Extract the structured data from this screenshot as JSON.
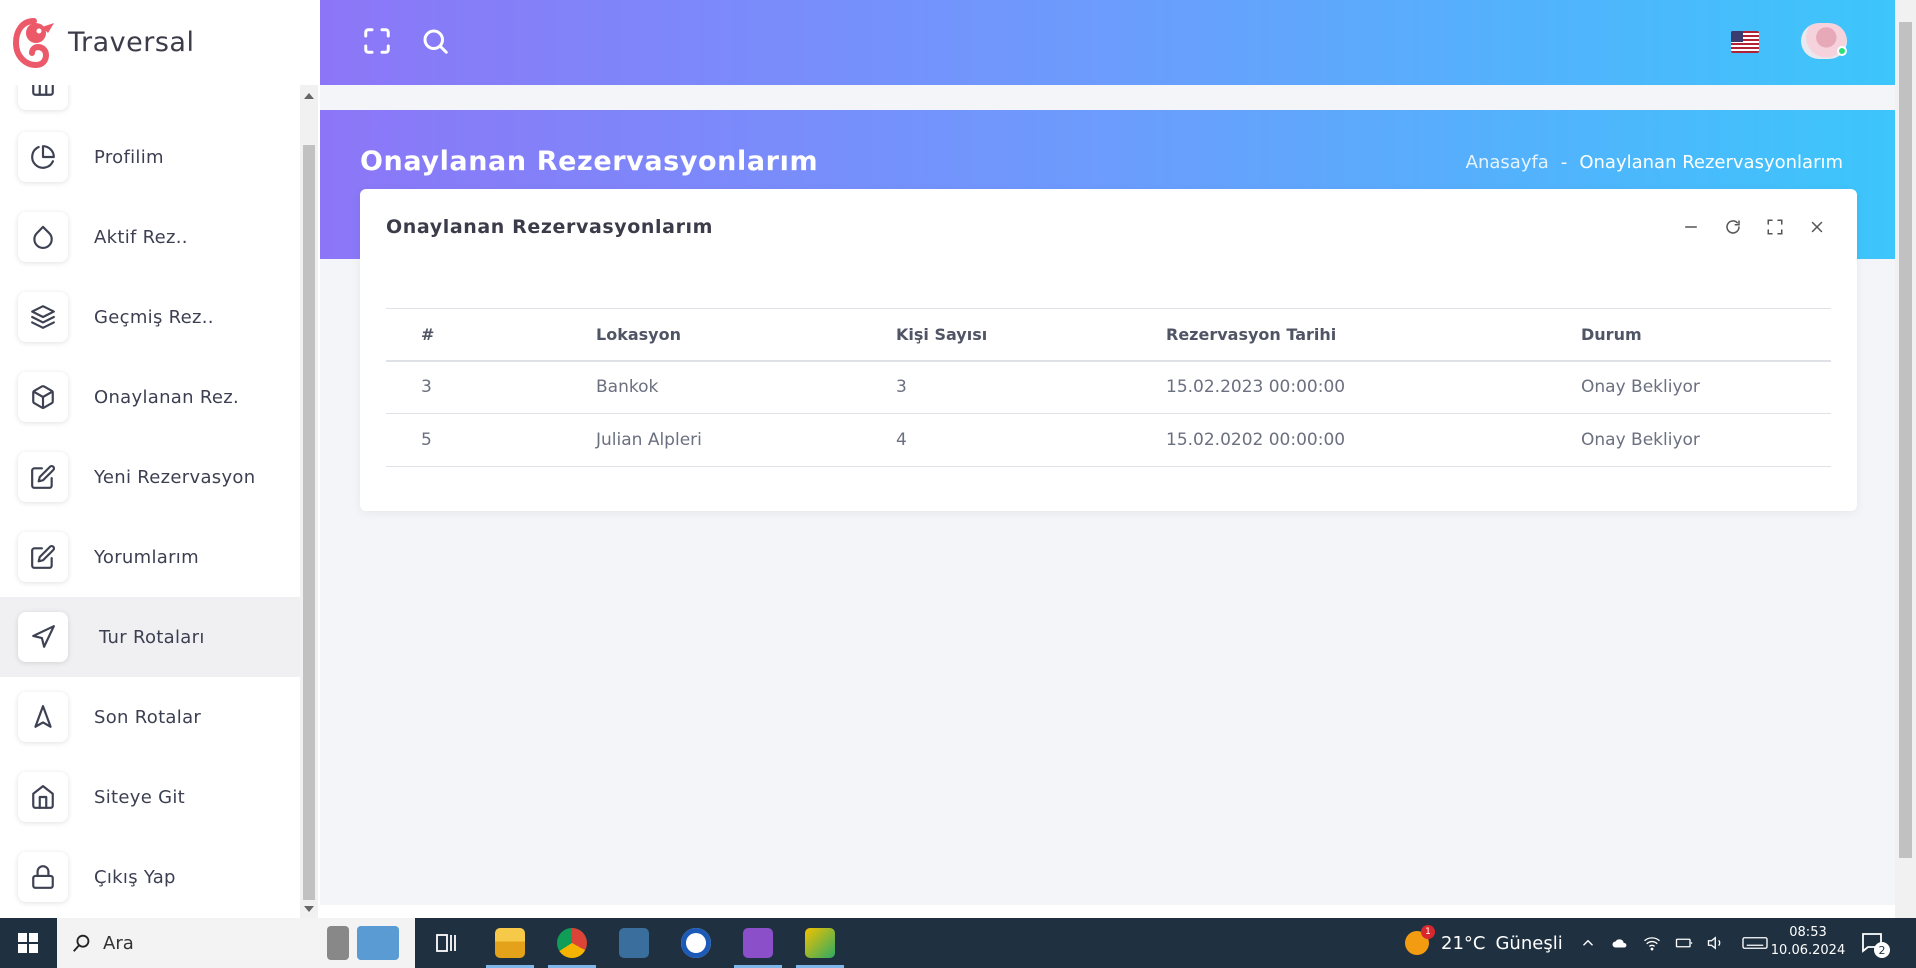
{
  "brand": {
    "name": "Traversal"
  },
  "sidebar": {
    "items": [
      {
        "label": "Profilim",
        "icon": "pie-chart-icon"
      },
      {
        "label": "Aktif Rez..",
        "icon": "droplet-icon"
      },
      {
        "label": "Geçmiş Rez..",
        "icon": "layers-icon"
      },
      {
        "label": "Onaylanan Rez.",
        "icon": "box-icon"
      },
      {
        "label": "Yeni Rezervasyon",
        "icon": "edit-icon"
      },
      {
        "label": "Yorumlarım",
        "icon": "edit-icon"
      },
      {
        "label": "Tur Rotaları",
        "icon": "navigation-icon",
        "active": true
      },
      {
        "label": "Son Rotalar",
        "icon": "navigation-2-icon"
      },
      {
        "label": "Siteye Git",
        "icon": "home-icon"
      },
      {
        "label": "Çıkış Yap",
        "icon": "lock-icon"
      }
    ]
  },
  "header": {
    "fullscreen_icon": "maximize-icon",
    "search_icon": "search-icon",
    "language_flag": "us-flag-icon",
    "avatar_status_color": "#2ee07a"
  },
  "page": {
    "title": "Onaylanan Rezervasyonlarım",
    "breadcrumb": {
      "home": "Anasayfa",
      "separator": "-",
      "current": "Onaylanan Rezervasyonlarım"
    }
  },
  "card": {
    "title": "Onaylanan Rezervasyonlarım",
    "tools": [
      "minus-icon",
      "refresh-icon",
      "maximize-icon",
      "close-icon"
    ]
  },
  "table": {
    "columns": [
      "#",
      "Lokasyon",
      "Kişi Sayısı",
      "Rezervasyon Tarihi",
      "Durum"
    ],
    "rows": [
      [
        "3",
        "Bankok",
        "3",
        "15.02.2023 00:00:00",
        "Onay Bekliyor"
      ],
      [
        "5",
        "Julian Alpleri",
        "4",
        "15.02.0202 00:00:00",
        "Onay Bekliyor"
      ]
    ]
  },
  "taskbar": {
    "search_placeholder": "Ara",
    "weather": {
      "temp": "21°C",
      "condition": "Güneşli",
      "badge": "1"
    },
    "clock": {
      "time": "08:53",
      "date": "10.06.2024"
    },
    "notification_count": "2"
  },
  "colors": {
    "gradient_start": "#8c76f7",
    "gradient_mid": "#6c9cfd",
    "gradient_end": "#3cc6fb",
    "taskbar": "#1f3140"
  }
}
